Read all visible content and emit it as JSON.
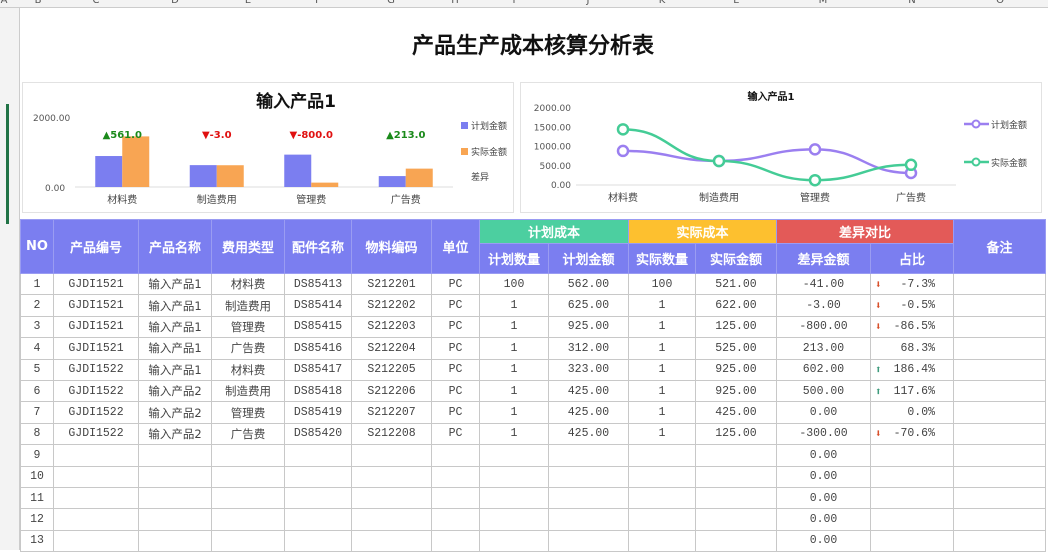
{
  "sheet": {
    "columns": [
      "A",
      "B",
      "C",
      "D",
      "E",
      "F",
      "G",
      "H",
      "I",
      "J",
      "K",
      "L",
      "M",
      "N",
      "O"
    ]
  },
  "title": "产品生产成本核算分析表",
  "chart_data": [
    {
      "type": "bar",
      "title": "输入产品1",
      "categories": [
        "材料费",
        "制造费用",
        "管理费",
        "广告费"
      ],
      "series": [
        {
          "name": "计划金额",
          "values": [
            885,
            625,
            925,
            312
          ],
          "color": "#7b7ef0"
        },
        {
          "name": "实际金额",
          "values": [
            1446,
            622,
            125,
            525
          ],
          "color": "#f8a553"
        },
        {
          "name": "差异",
          "values": [
            561,
            -3,
            -800,
            213
          ]
        }
      ],
      "data_labels": [
        "▲561.0",
        "▼-3.0",
        "▼-800.0",
        "▲213.0"
      ],
      "yticks": [
        "0.00",
        "2000.00"
      ],
      "ylim": [
        0,
        2000
      ],
      "legend": "right"
    },
    {
      "type": "line",
      "title": "输入产品1",
      "categories": [
        "材料费",
        "制造费用",
        "管理费",
        "广告费"
      ],
      "series": [
        {
          "name": "计划金额",
          "values": [
            885,
            625,
            925,
            312
          ],
          "color": "#9b7ff0"
        },
        {
          "name": "实际金额",
          "values": [
            1446,
            622,
            125,
            525
          ],
          "color": "#44cc96"
        }
      ],
      "yticks": [
        "0.00",
        "500.00",
        "1000.00",
        "1500.00",
        "2000.00"
      ],
      "ylim": [
        0,
        2000
      ],
      "legend": "right"
    }
  ],
  "table": {
    "headers": {
      "no": "NO",
      "code": "产品编号",
      "name": "产品名称",
      "type": "费用类型",
      "part": "配件名称",
      "mat": "物料编码",
      "unit": "单位",
      "plan": "计划成本",
      "actual": "实际成本",
      "diff": "差异对比",
      "remark": "备注",
      "plan_qty": "计划数量",
      "plan_amt": "计划金额",
      "act_qty": "实际数量",
      "act_amt": "实际金额",
      "diff_amt": "差异金额",
      "ratio": "占比"
    },
    "rows": [
      [
        "1",
        "GJDI1521",
        "输入产品1",
        "材料费",
        "DS85413",
        "S212201",
        "PC",
        "100",
        "562.00",
        "100",
        "521.00",
        "-41.00",
        "-7.3%",
        "down"
      ],
      [
        "2",
        "GJDI1521",
        "输入产品1",
        "制造费用",
        "DS85414",
        "S212202",
        "PC",
        "1",
        "625.00",
        "1",
        "622.00",
        "-3.00",
        "-0.5%",
        "down"
      ],
      [
        "3",
        "GJDI1521",
        "输入产品1",
        "管理费",
        "DS85415",
        "S212203",
        "PC",
        "1",
        "925.00",
        "1",
        "125.00",
        "-800.00",
        "-86.5%",
        "down"
      ],
      [
        "4",
        "GJDI1521",
        "输入产品1",
        "广告费",
        "DS85416",
        "S212204",
        "PC",
        "1",
        "312.00",
        "1",
        "525.00",
        "213.00",
        "68.3%",
        ""
      ],
      [
        "5",
        "GJDI1522",
        "输入产品1",
        "材料费",
        "DS85417",
        "S212205",
        "PC",
        "1",
        "323.00",
        "1",
        "925.00",
        "602.00",
        "186.4%",
        "up"
      ],
      [
        "6",
        "GJDI1522",
        "输入产品2",
        "制造费用",
        "DS85418",
        "S212206",
        "PC",
        "1",
        "425.00",
        "1",
        "925.00",
        "500.00",
        "117.6%",
        "up"
      ],
      [
        "7",
        "GJDI1522",
        "输入产品2",
        "管理费",
        "DS85419",
        "S212207",
        "PC",
        "1",
        "425.00",
        "1",
        "425.00",
        "0.00",
        "0.0%",
        ""
      ],
      [
        "8",
        "GJDI1522",
        "输入产品2",
        "广告费",
        "DS85420",
        "S212208",
        "PC",
        "1",
        "425.00",
        "1",
        "125.00",
        "-300.00",
        "-70.6%",
        "down"
      ],
      [
        "9",
        "",
        "",
        "",
        "",
        "",
        "",
        "",
        "",
        "",
        "",
        "0.00",
        "",
        ""
      ],
      [
        "10",
        "",
        "",
        "",
        "",
        "",
        "",
        "",
        "",
        "",
        "",
        "0.00",
        "",
        ""
      ],
      [
        "11",
        "",
        "",
        "",
        "",
        "",
        "",
        "",
        "",
        "",
        "",
        "0.00",
        "",
        ""
      ],
      [
        "12",
        "",
        "",
        "",
        "",
        "",
        "",
        "",
        "",
        "",
        "",
        "0.00",
        "",
        ""
      ],
      [
        "13",
        "",
        "",
        "",
        "",
        "",
        "",
        "",
        "",
        "",
        "",
        "0.00",
        "",
        ""
      ]
    ]
  }
}
